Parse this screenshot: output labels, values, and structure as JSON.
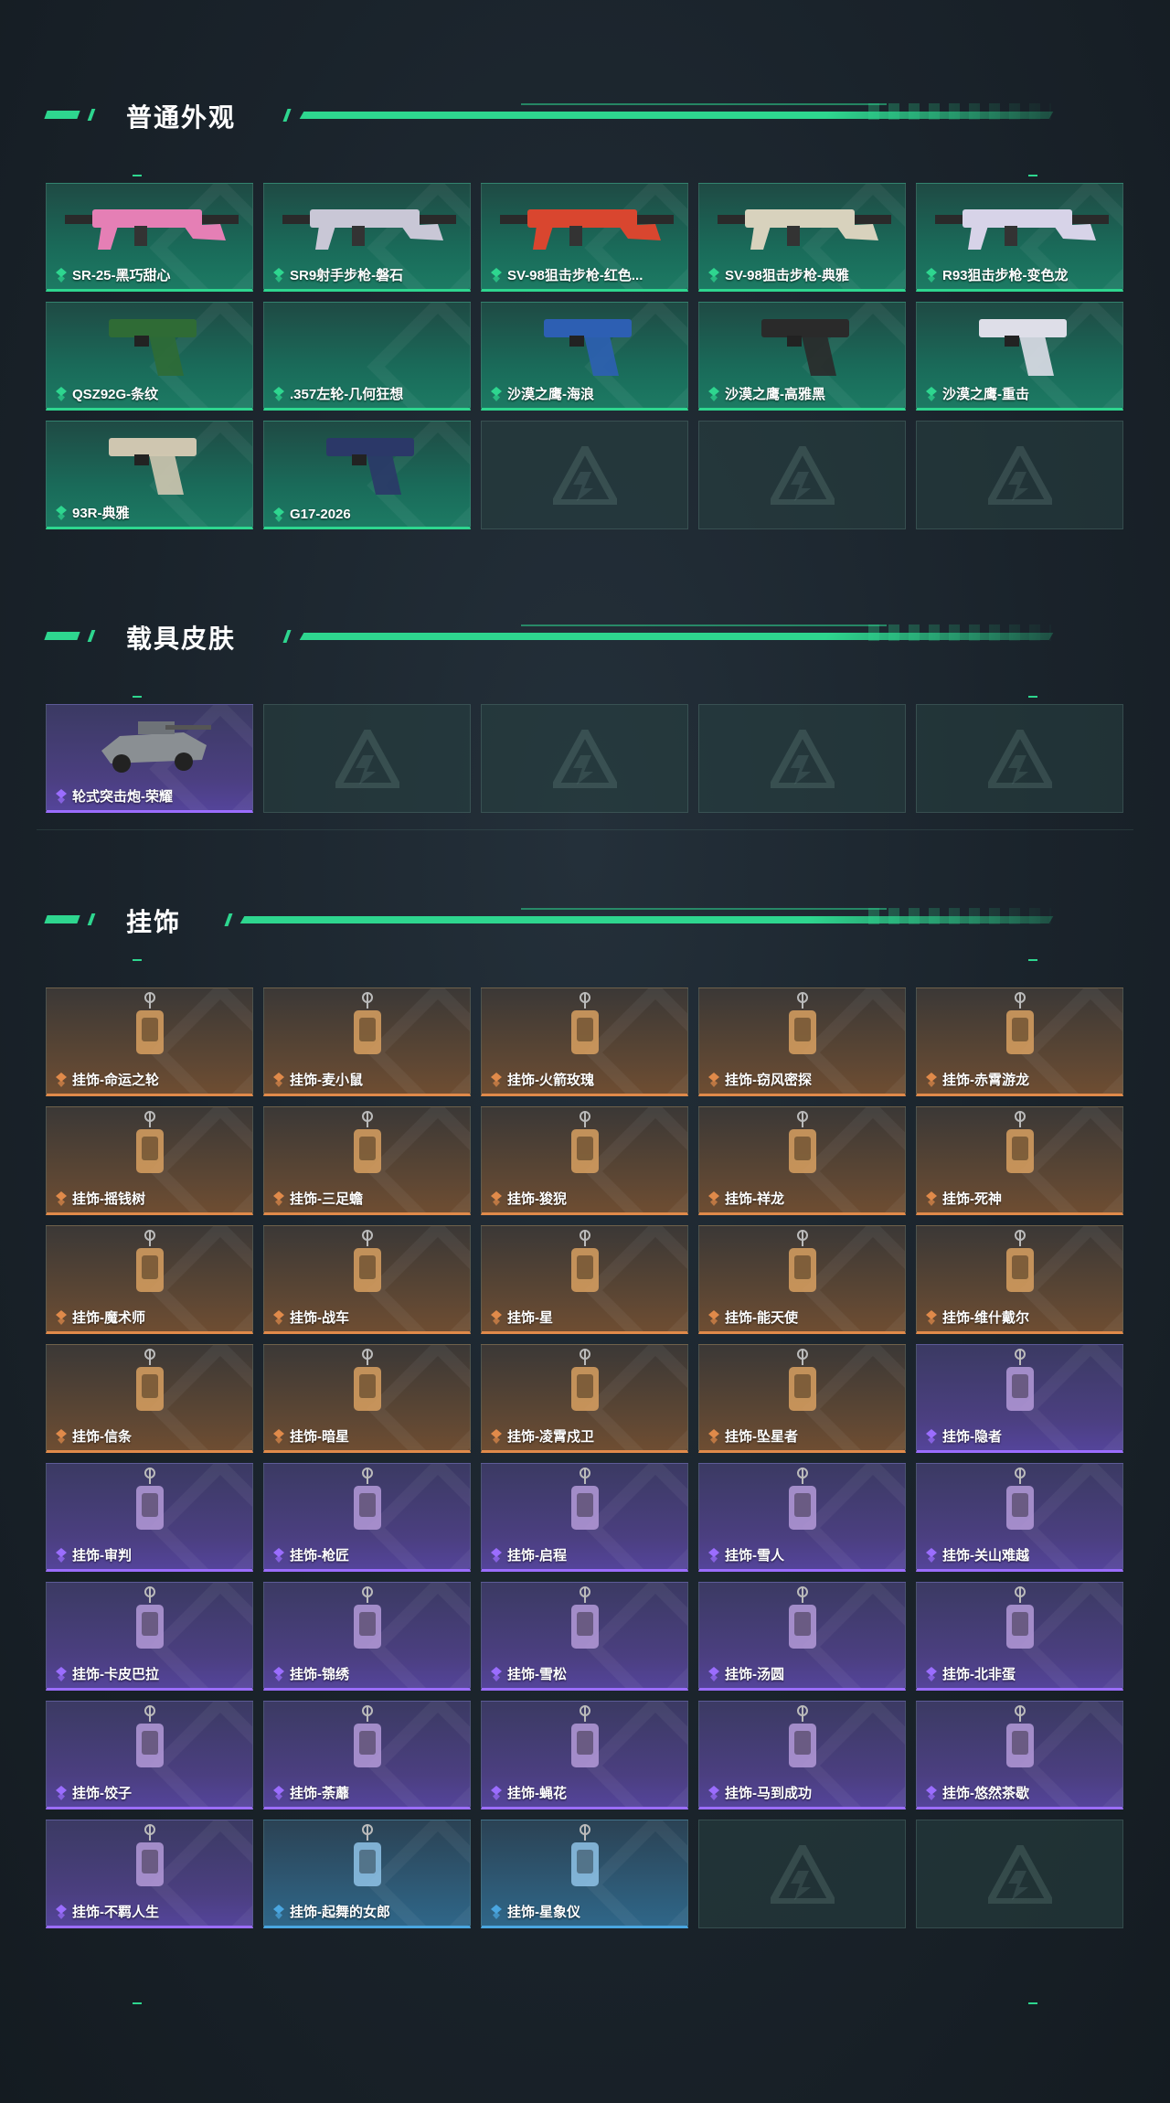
{
  "sections": {
    "skins": {
      "title": "普通外观",
      "items": [
        {
          "label": "SR-25-黑巧甜心",
          "rarity": "green",
          "icon": "rifle-pink-icon"
        },
        {
          "label": "SR9射手步枪-磐石",
          "rarity": "green",
          "icon": "rifle-silver-icon"
        },
        {
          "label": "SV-98狙击步枪-红色...",
          "rarity": "green",
          "icon": "sniper-red-icon"
        },
        {
          "label": "SV-98狙击步枪-典雅",
          "rarity": "green",
          "icon": "sniper-beige-icon"
        },
        {
          "label": "R93狙击步枪-变色龙",
          "rarity": "green",
          "icon": "sniper-white-icon"
        },
        {
          "label": "QSZ92G-条纹",
          "rarity": "green",
          "icon": "pistol-green-icon"
        },
        {
          "label": ".357左轮-几何狂想",
          "rarity": "green",
          "icon": ""
        },
        {
          "label": "沙漠之鹰-海浪",
          "rarity": "green",
          "icon": "pistol-blue-icon"
        },
        {
          "label": "沙漠之鹰-高雅黑",
          "rarity": "green",
          "icon": "pistol-black-icon"
        },
        {
          "label": "沙漠之鹰-重击",
          "rarity": "green",
          "icon": "pistol-white-icon"
        },
        {
          "label": "93R-典雅",
          "rarity": "green",
          "icon": "pistol-beige-icon"
        },
        {
          "label": "G17-2026",
          "rarity": "green",
          "icon": "pistol-navy-icon"
        },
        {
          "label": "",
          "rarity": "empty"
        },
        {
          "label": "",
          "rarity": "empty"
        },
        {
          "label": "",
          "rarity": "empty"
        }
      ]
    },
    "vehicles": {
      "title": "载具皮肤",
      "items": [
        {
          "label": "轮式突击炮-荣耀",
          "rarity": "purple",
          "icon": "vehicle-icon"
        },
        {
          "label": "",
          "rarity": "empty"
        },
        {
          "label": "",
          "rarity": "empty"
        },
        {
          "label": "",
          "rarity": "empty"
        },
        {
          "label": "",
          "rarity": "empty"
        }
      ]
    },
    "charms": {
      "title": "挂饰",
      "items": [
        {
          "label": "挂饰-命运之轮",
          "rarity": "orange",
          "icon": "card-charm-icon"
        },
        {
          "label": "挂饰-麦小鼠",
          "rarity": "orange",
          "icon": "mouse-charm-icon"
        },
        {
          "label": "挂饰-火箭玫瑰",
          "rarity": "orange",
          "icon": "figure-charm-icon"
        },
        {
          "label": "挂饰-窃风密探",
          "rarity": "orange",
          "icon": "figure-charm-icon"
        },
        {
          "label": "挂饰-赤霄游龙",
          "rarity": "orange",
          "icon": "dragon-charm-icon"
        },
        {
          "label": "挂饰-摇钱树",
          "rarity": "orange",
          "icon": "tree-charm-icon"
        },
        {
          "label": "挂饰-三足蟾",
          "rarity": "orange",
          "icon": "toad-charm-icon"
        },
        {
          "label": "挂饰-狻猊",
          "rarity": "orange",
          "icon": "lion-charm-icon"
        },
        {
          "label": "挂饰-祥龙",
          "rarity": "orange",
          "icon": "dragon-charm-icon"
        },
        {
          "label": "挂饰-死神",
          "rarity": "orange",
          "icon": "card-charm-icon"
        },
        {
          "label": "挂饰-魔术师",
          "rarity": "orange",
          "icon": "card-charm-icon"
        },
        {
          "label": "挂饰-战车",
          "rarity": "orange",
          "icon": "card-charm-icon"
        },
        {
          "label": "挂饰-星",
          "rarity": "orange",
          "icon": "card-charm-icon"
        },
        {
          "label": "挂饰-能天使",
          "rarity": "orange",
          "icon": "tag-charm-icon"
        },
        {
          "label": "挂饰-维什戴尔",
          "rarity": "orange",
          "icon": "tag-charm-icon"
        },
        {
          "label": "挂饰-信条",
          "rarity": "orange",
          "icon": "figure-charm-icon"
        },
        {
          "label": "挂饰-暗星",
          "rarity": "orange",
          "icon": "bird-charm-icon"
        },
        {
          "label": "挂饰-凌霄戍卫",
          "rarity": "orange",
          "icon": "figure-charm-icon"
        },
        {
          "label": "挂饰-坠星者",
          "rarity": "orange",
          "icon": "crystal-charm-icon"
        },
        {
          "label": "挂饰-隐者",
          "rarity": "purple",
          "icon": "card-charm-icon"
        },
        {
          "label": "挂饰-审判",
          "rarity": "purple",
          "icon": "card-charm-icon"
        },
        {
          "label": "挂饰-枪匠",
          "rarity": "purple",
          "icon": "hex-charm-icon"
        },
        {
          "label": "挂饰-启程",
          "rarity": "purple",
          "icon": "badge-charm-icon"
        },
        {
          "label": "挂饰-雪人",
          "rarity": "purple",
          "icon": "snowman-charm-icon"
        },
        {
          "label": "挂饰-关山难越",
          "rarity": "purple",
          "icon": "bottle-charm-icon"
        },
        {
          "label": "挂饰-卡皮巴拉",
          "rarity": "purple",
          "icon": "capybara-charm-icon"
        },
        {
          "label": "挂饰-锦绣",
          "rarity": "purple",
          "icon": "butterfly-charm-icon"
        },
        {
          "label": "挂饰-雪松",
          "rarity": "purple",
          "icon": "tree-charm-icon"
        },
        {
          "label": "挂饰-汤圆",
          "rarity": "purple",
          "icon": "bowl-charm-icon"
        },
        {
          "label": "挂饰-北非蛋",
          "rarity": "purple",
          "icon": "dish-charm-icon"
        },
        {
          "label": "挂饰-饺子",
          "rarity": "purple",
          "icon": "dish-charm-icon"
        },
        {
          "label": "挂饰-荼蘼",
          "rarity": "purple",
          "icon": "flower-charm-icon"
        },
        {
          "label": "挂饰-蝇花",
          "rarity": "purple",
          "icon": "flower-charm-icon"
        },
        {
          "label": "挂饰-马到成功",
          "rarity": "purple",
          "icon": "horse-charm-icon"
        },
        {
          "label": "挂饰-悠然茶歇",
          "rarity": "purple",
          "icon": "cake-charm-icon"
        },
        {
          "label": "挂饰-不羁人生",
          "rarity": "purple",
          "icon": "shoe-charm-icon"
        },
        {
          "label": "挂饰-起舞的女郎",
          "rarity": "blue",
          "icon": "dancer-charm-icon"
        },
        {
          "label": "挂饰-星象仪",
          "rarity": "blue",
          "icon": "astrolabe-charm-icon"
        },
        {
          "label": "",
          "rarity": "empty"
        },
        {
          "label": "",
          "rarity": "empty"
        }
      ]
    }
  },
  "colors": {
    "accent": "#2ed68f",
    "green": "#2ed68f",
    "purple": "#9b6dff",
    "orange": "#e08a4a",
    "blue": "#4aa6e0"
  }
}
